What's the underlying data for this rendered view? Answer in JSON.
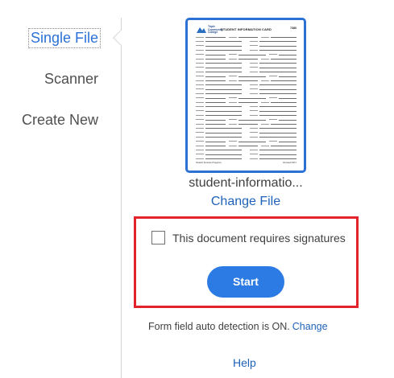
{
  "nav": {
    "items": [
      {
        "label": "Single File",
        "active": true
      },
      {
        "label": "Scanner",
        "active": false
      },
      {
        "label": "Create New",
        "active": false
      }
    ]
  },
  "file": {
    "name": "student-informatio...",
    "change_label": "Change File",
    "thumbnail": {
      "logo_text": "Triple\nCommunity\nCollege",
      "title": "STUDENT INFORMATION CARD",
      "code": "7380",
      "footer_left": "Student Services Programs",
      "footer_right": "Revised 03/17"
    }
  },
  "options": {
    "signature_checkbox_label": "This document requires signatures",
    "signature_checked": false
  },
  "start_label": "Start",
  "autodetect": {
    "text": "Form field auto detection is ON.",
    "link": "Change"
  },
  "help_label": "Help",
  "colors": {
    "accent": "#2c7ae3",
    "link": "#1f62b8",
    "highlight_border": "#e3232b"
  }
}
